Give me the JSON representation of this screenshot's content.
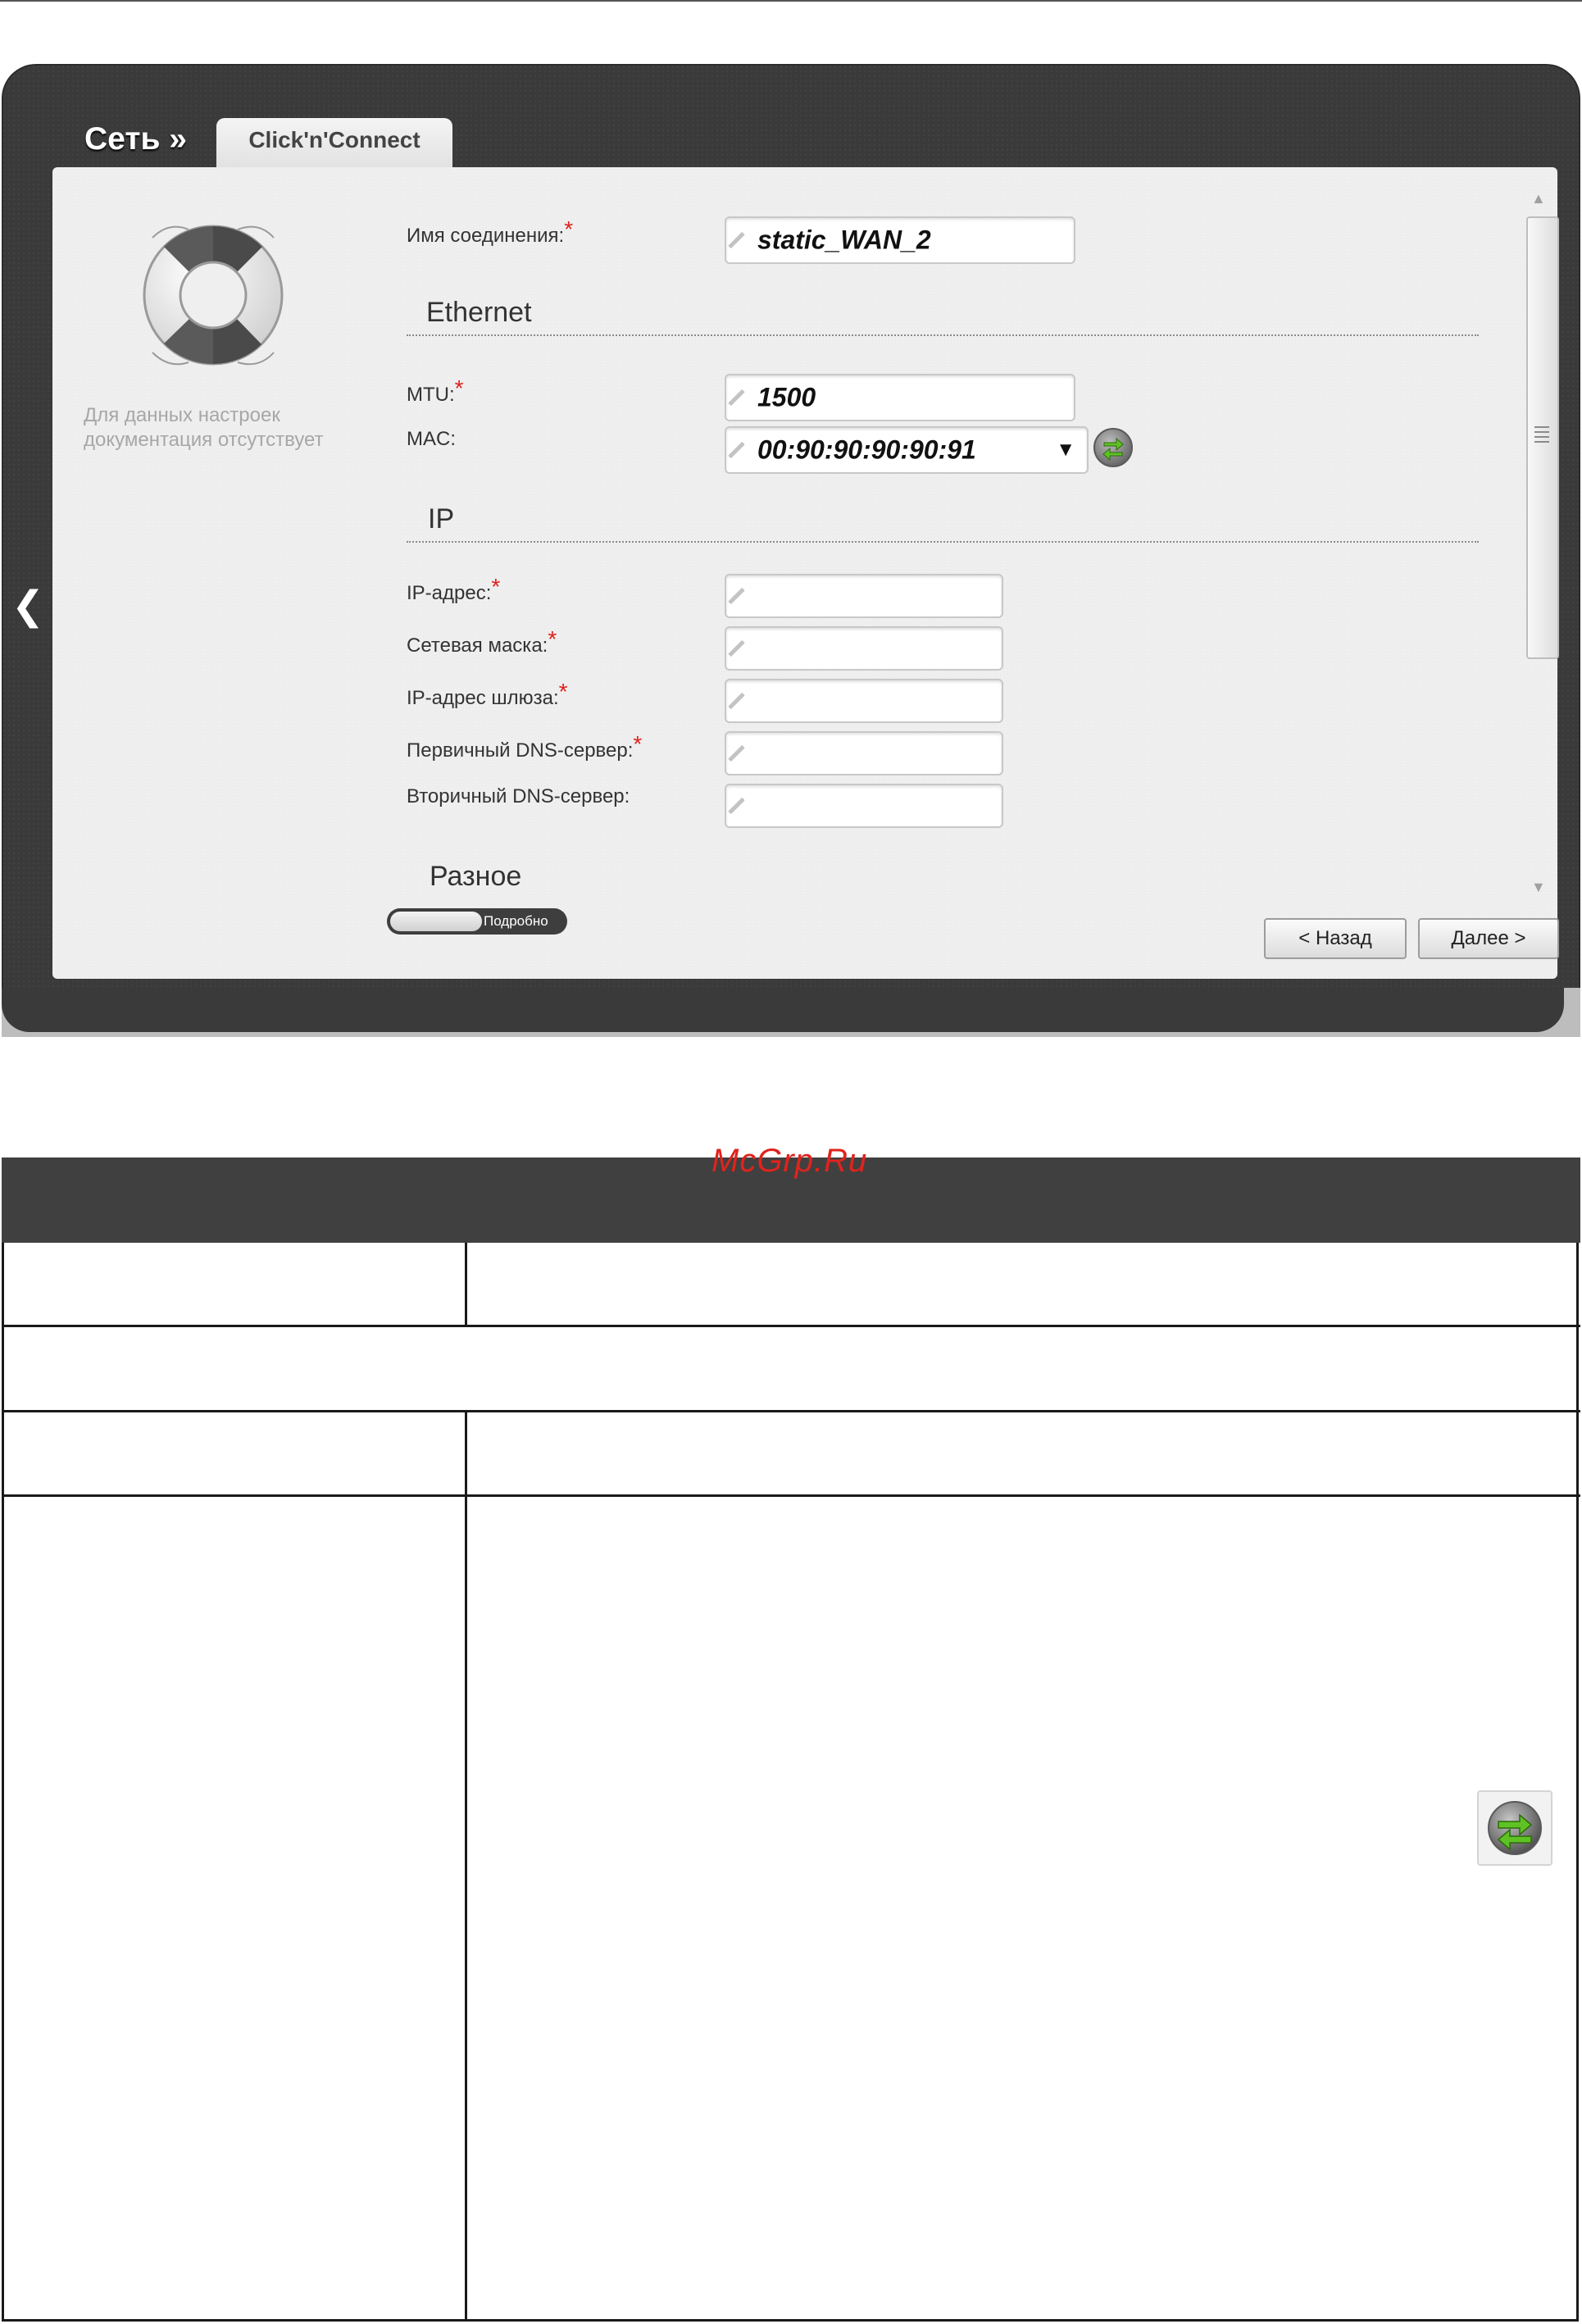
{
  "router": {
    "breadcrumb": "Сеть »",
    "tab": "Click'n'Connect",
    "help_text": "Для данных настроек документация отсутствует",
    "connection_name": {
      "label": "Имя соединения:",
      "required": "*",
      "value": "static_WAN_2"
    },
    "sections": {
      "ethernet": "Ethernet",
      "ip": "IP",
      "misc": "Разное"
    },
    "mtu": {
      "label": "MTU:",
      "required": "*",
      "value": "1500"
    },
    "mac": {
      "label": "MAC:",
      "value": "00:90:90:90:90:91"
    },
    "ip_address": {
      "label": "IP-адрес:",
      "required": "*",
      "value": ""
    },
    "netmask": {
      "label": "Сетевая маска:",
      "required": "*",
      "value": ""
    },
    "gateway": {
      "label": "IP-адрес шлюза:",
      "required": "*",
      "value": ""
    },
    "dns_primary": {
      "label": "Первичный DNS-сервер:",
      "required": "*",
      "value": ""
    },
    "dns_secondary": {
      "label": "Вторичный DNS-сервер:",
      "value": ""
    },
    "toggle_label": "Подробно",
    "back_button": "< Назад",
    "next_button": "Далее >"
  },
  "document": {
    "watermark": "McGrp.Ru"
  },
  "icons": {
    "side_arrow": "chevron-left-icon",
    "help": "lifebuoy-icon",
    "clone_mac": "swap-arrows-icon",
    "pencil": "pencil-icon",
    "dropdown": "caret-down-icon"
  },
  "colors": {
    "required": "#e0201b",
    "frame": "#3a3a3a",
    "table_header": "#404040",
    "watermark": "#e0231d"
  }
}
